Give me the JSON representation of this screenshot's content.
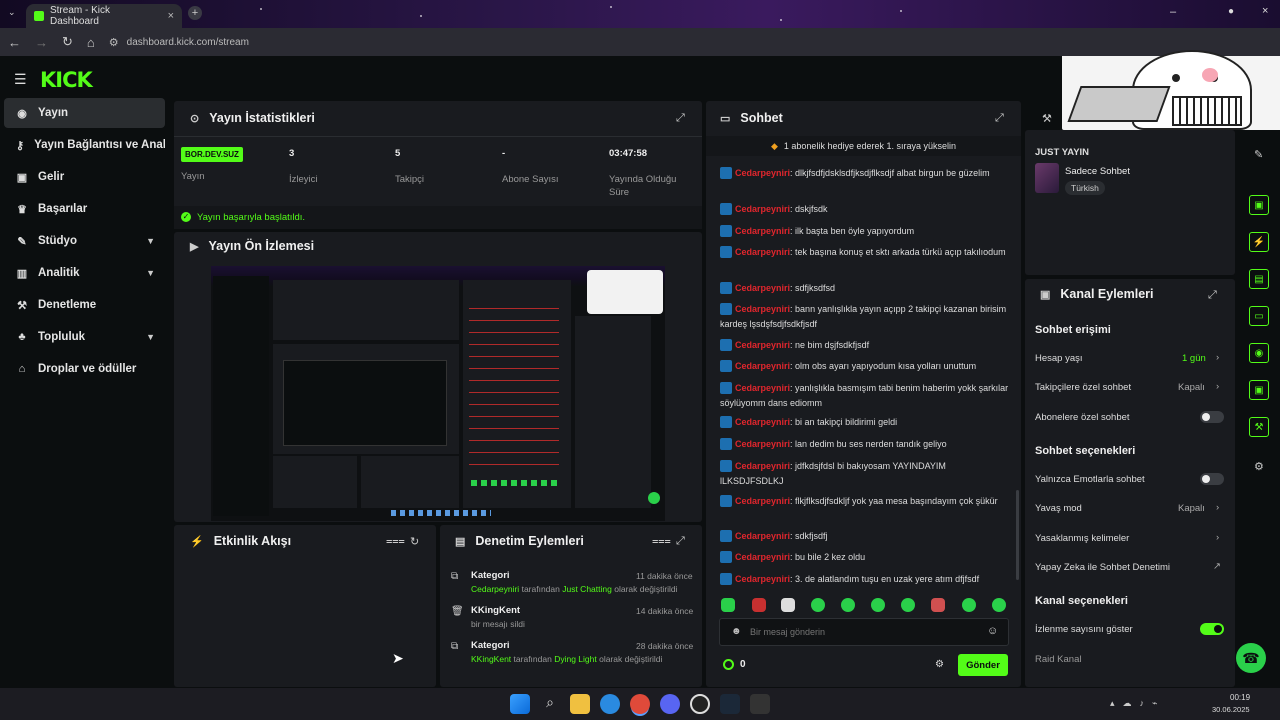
{
  "browser": {
    "tab_title": "Stream - Kick Dashboard",
    "url": "dashboard.kick.com/stream"
  },
  "logo": "KICK",
  "sidebar": {
    "items": [
      {
        "label": "Yayın",
        "icon": "broadcast-icon"
      },
      {
        "label": "Yayın Bağlantısı ve Anahtar",
        "icon": "key-icon"
      },
      {
        "label": "Gelir",
        "icon": "money-icon"
      },
      {
        "label": "Başarılar",
        "icon": "trophy-icon"
      },
      {
        "label": "Stüdyo",
        "icon": "studio-icon"
      },
      {
        "label": "Analitik",
        "icon": "chart-icon"
      },
      {
        "label": "Denetleme",
        "icon": "wrench-icon"
      },
      {
        "label": "Topluluk",
        "icon": "community-icon"
      },
      {
        "label": "Droplar ve ödüller",
        "icon": "gift-icon"
      }
    ]
  },
  "stats": {
    "title": "Yayın İstatistikleri",
    "status_badge": "BOR.DEV.SUZ",
    "status_label": "Yayın",
    "viewers_value": "3",
    "viewers_label": "İzleyici",
    "followers_value": "5",
    "followers_label": "Takipçi",
    "subs_value": "-",
    "subs_label": "Abone Sayısı",
    "uptime_value": "03:47:58",
    "uptime_label": "Yayında Olduğu Süre",
    "success_msg": "Yayın başarıyla başlatıldı."
  },
  "preview": {
    "title": "Yayın Ön İzlemesi"
  },
  "activity": {
    "title": "Etkinlik Akışı"
  },
  "moderation": {
    "title": "Denetim Eylemleri",
    "items": [
      {
        "title": "Kategori",
        "time": "11 dakika önce",
        "user": "Cedarpeyniri",
        "mid": "tarafından",
        "value": "Just Chatting",
        "end": "olarak değiştirildi"
      },
      {
        "title": "KKingKent",
        "time": "14 dakika önce",
        "line": "bir mesajı sildi"
      },
      {
        "title": "Kategori",
        "time": "28 dakika önce",
        "user": "KKingKent",
        "mid": "tarafından",
        "value": "Dying Light",
        "end": "olarak değiştirildi"
      }
    ]
  },
  "chat": {
    "title": "Sohbet",
    "banner": "1 abonelik hediye ederek 1. sıraya yükselin",
    "username": "Cedarpeyniri",
    "messages": [
      "dlkjfsdfjdsklsdfjksdjflksdjf albat birgun be güzelim",
      "dskjfsdk",
      "ilk başta ben öyle yapıyordum",
      "tek başına konuş et sktı arkada türkü açıp takılıodum",
      "sdfjksdfsd",
      "bann yanlışlıkla yayın açıpp 2 takipçi kazanan birisim kardeş lşsdşfsdjfsdkfjsdf",
      "ne bim dşjfsdkfjsdf",
      "olm obs ayarı yapıyodum kısa yolları unuttum",
      "yanlışlıkla basmışım tabi benim haberim yokk şarkılar söylüyomm dans ediomm",
      "bi an takipçi bildirimi geldi",
      "lan dedim bu ses nerden tandık geliyo",
      "jdfkdsjfdsl bi bakıyosam YAYINDAYIM lLKSDJFSDLKJ",
      "flkjflksdjfsdkljf yok yaa mesa başındayım çok şükür",
      "sdkfjsdfj",
      "bu bile 2 kez oldu",
      "3. de alatlandım tuşu en uzak yere atım dfjfsdf"
    ],
    "input_placeholder": "Bir mesaj gönderin",
    "points": "0",
    "send_label": "Gönder"
  },
  "channel": {
    "just_label": "JUST YAYIN",
    "mode": "Sadece Sohbet",
    "language": "Türkish",
    "actions_title": "Kanal Eylemleri",
    "chat_access": "Sohbet erişimi",
    "account_age_label": "Hesap yaşı",
    "account_age_value": "1 gün",
    "followers_only_label": "Takipçilere özel sohbet",
    "followers_only_value": "Kapalı",
    "subs_only_label": "Abonelere özel sohbet",
    "chat_options": "Sohbet seçenekleri",
    "emote_only_label": "Yalnızca Emotlarla sohbet",
    "slow_mode_label": "Yavaş mod",
    "slow_mode_value": "Kapalı",
    "banned_words_label": "Yasaklanmış kelimeler",
    "ai_mod_label": "Yapay Zeka ile Sohbet Denetimi",
    "channel_options": "Kanal seçenekleri",
    "show_viewers_label": "İzlenme sayısını göster",
    "raid_label": "Raid Kanal"
  },
  "taskbar": {
    "time": "00:19",
    "date": "30.06.2025"
  },
  "colors": {
    "accent": "#53fc18",
    "username": "#e0262d",
    "panel": "#191b1f",
    "bg": "#0b0e0f"
  }
}
